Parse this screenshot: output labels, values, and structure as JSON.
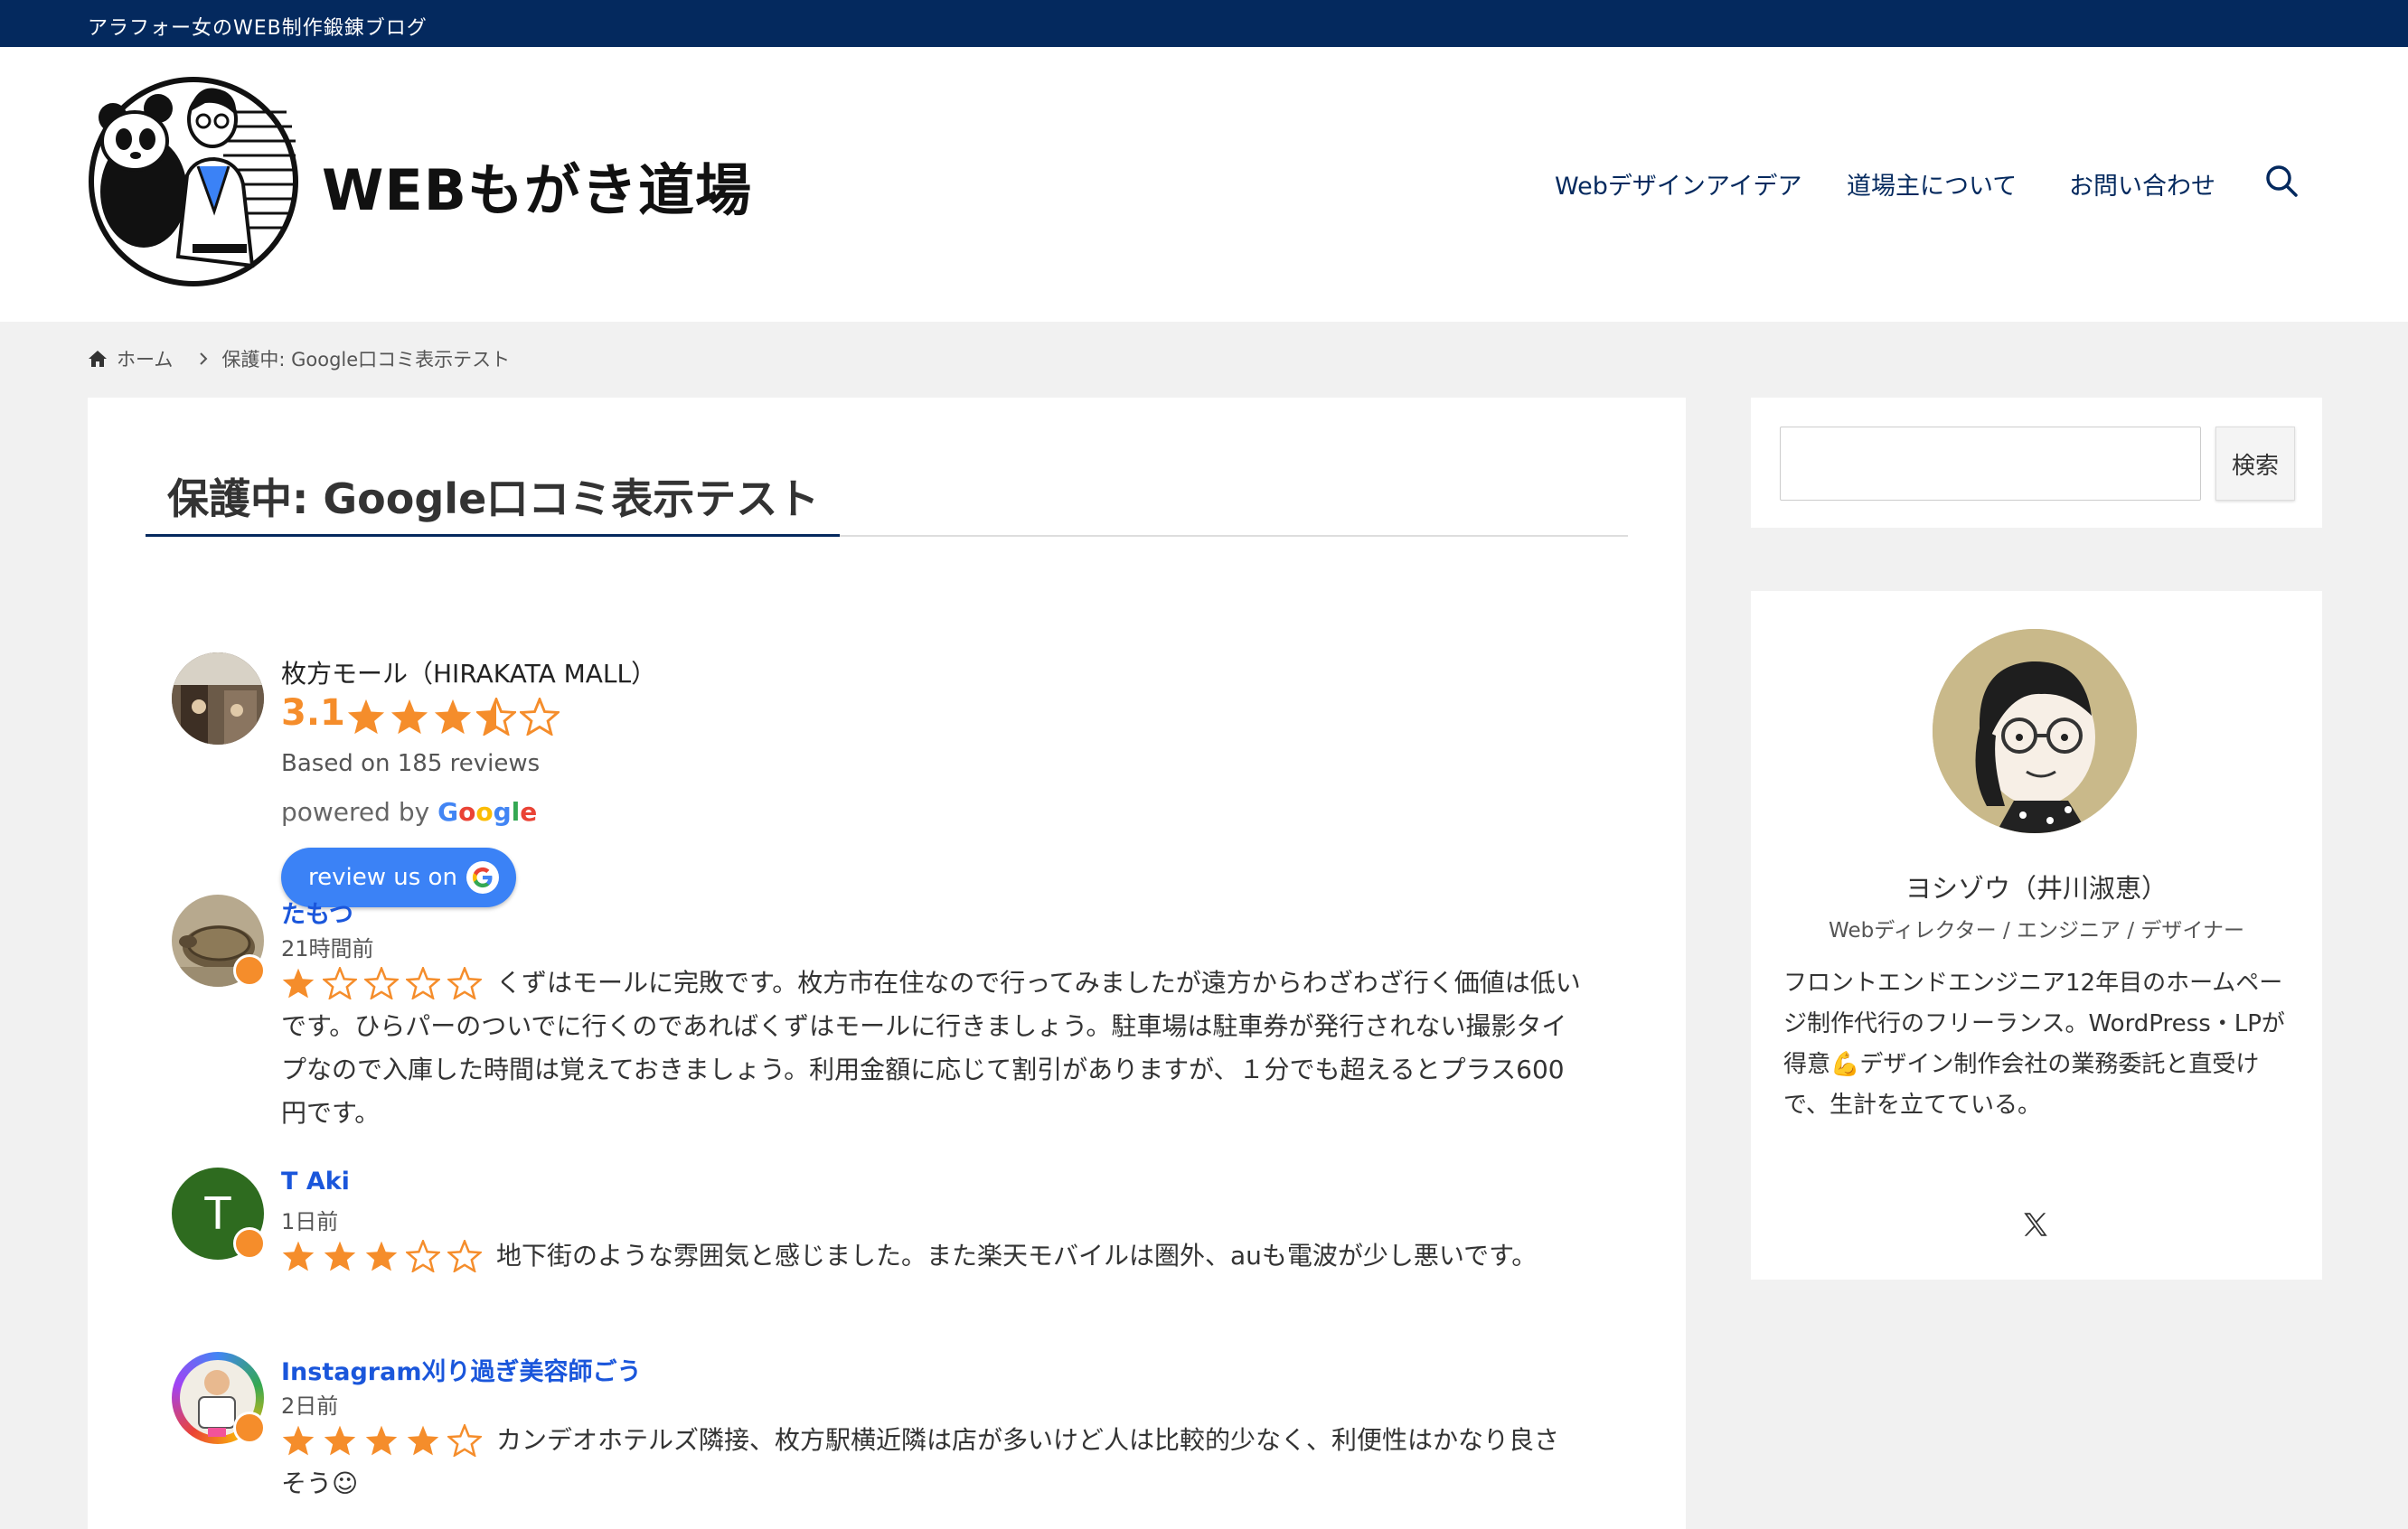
{
  "site": {
    "tagline": "アラフォー女のWEB制作鍛錬ブログ",
    "logo_text": "WEBもがき道場"
  },
  "nav": {
    "items": [
      {
        "label": "Webデザインアイデア"
      },
      {
        "label": "道場主について"
      },
      {
        "label": "お問い合わせ"
      }
    ]
  },
  "breadcrumb": {
    "home": "ホーム",
    "current": "保護中: Google口コミ表示テスト"
  },
  "post": {
    "title": "保護中: Google口コミ表示テスト"
  },
  "business": {
    "name": "枚方モール（HIRAKATA MALL）",
    "rating": "3.1",
    "rating_value": 3.1,
    "based_on": "Based on 185 reviews",
    "powered_by": "powered by",
    "google_word": "Google",
    "review_button": "review us on"
  },
  "reviews": [
    {
      "name": "たもつ",
      "time": "21時間前",
      "stars": 1,
      "text": "くずはモールに完敗です。枚方市在住なので行ってみましたが遠方からわざわざ行く価値は低いです。ひらパーのついでに行くのであればくずはモールに行きましょう。駐車場は駐車券が発行されない撮影タイプなので入庫した時間は覚えておきましょう。利用金額に応じて割引がありますが、１分でも超えるとプラス600円です。"
    },
    {
      "name": "T Aki",
      "initial": "T",
      "time": "1日前",
      "stars": 3,
      "text": "地下街のような雰囲気と感じました。また楽天モバイルは圏外、auも電波が少し悪いです。"
    },
    {
      "name": "Instagram刈り過ぎ美容師ごう",
      "time": "2日前",
      "stars": 4,
      "text": "カンデオホテルズ隣接、枚方駅横近隣は店が多いけど人は比較的少なく、利便性はかなり良さそう☺"
    }
  ],
  "sidebar": {
    "search_button": "検索",
    "profile": {
      "name": "ヨシゾウ（井川淑恵）",
      "role": "Webディレクター / エンジニア / デザイナー",
      "bio": "フロントエンドエンジニア12年目のホームページ制作代行のフリーランス。WordPress・LPが得意💪デザイン制作会社の業務委託と直受けで、生計を立てている。"
    }
  },
  "colors": {
    "navy": "#04295e",
    "star": "#f58d2b",
    "link": "#1a56db",
    "button": "#3b82f6"
  },
  "icons": [
    "home-icon",
    "chevron-right-icon",
    "search-icon",
    "x-logo-icon",
    "google-g-icon",
    "star-icon"
  ]
}
